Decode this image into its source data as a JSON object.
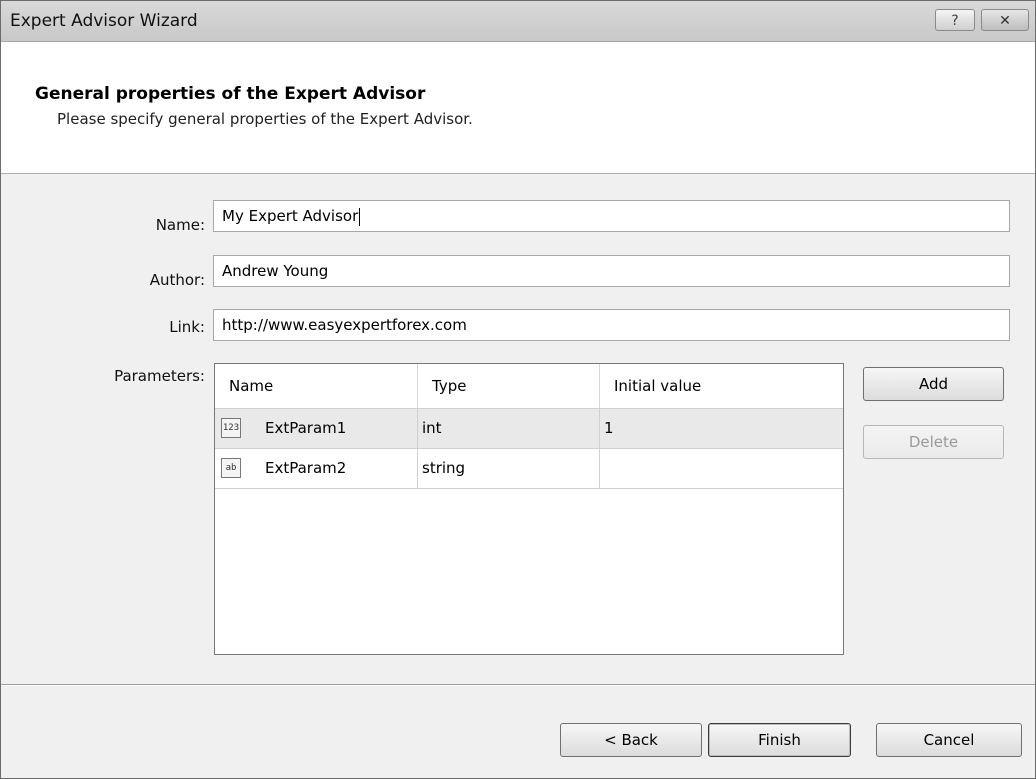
{
  "window": {
    "title": "Expert Advisor Wizard",
    "help_label": "?",
    "close_label": "✕"
  },
  "header": {
    "title": "General properties of the Expert Advisor",
    "subtitle": "Please specify general properties of the Expert Advisor."
  },
  "form": {
    "name_label": "Name:",
    "name_value": "My Expert Advisor",
    "author_label": "Author:",
    "author_value": "Andrew Young",
    "link_label": "Link:",
    "link_value": "http://www.easyexpertforex.com",
    "parameters_label": "Parameters:"
  },
  "parameters": {
    "columns": [
      "Name",
      "Type",
      "Initial value"
    ],
    "rows": [
      {
        "icon": "integer-param-icon",
        "icon_text": "123",
        "name": "ExtParam1",
        "type": "int",
        "initial": "1",
        "selected": true
      },
      {
        "icon": "string-param-icon",
        "icon_text": "ab",
        "name": "ExtParam2",
        "type": "string",
        "initial": "",
        "selected": false
      }
    ],
    "add_label": "Add",
    "delete_label": "Delete"
  },
  "footer": {
    "back_label": "< Back",
    "finish_label": "Finish",
    "cancel_label": "Cancel"
  }
}
